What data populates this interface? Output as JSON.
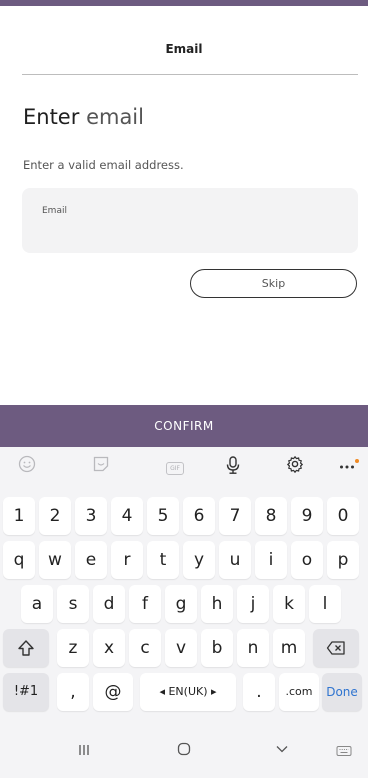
{
  "header": {
    "title": "Email"
  },
  "heading": {
    "strong": "Enter",
    "light": "email"
  },
  "hint": "Enter a valid email address.",
  "email_field": {
    "label": "Email",
    "value": "",
    "placeholder": ""
  },
  "skip_label": "Skip",
  "confirm_label": "CONFIRM",
  "keyboard": {
    "number_row": [
      "1",
      "2",
      "3",
      "4",
      "5",
      "6",
      "7",
      "8",
      "9",
      "0"
    ],
    "row1": [
      "q",
      "w",
      "e",
      "r",
      "t",
      "y",
      "u",
      "i",
      "o",
      "p"
    ],
    "row2": [
      "a",
      "s",
      "d",
      "f",
      "g",
      "h",
      "j",
      "k",
      "l"
    ],
    "row3": [
      "z",
      "x",
      "c",
      "v",
      "b",
      "n",
      "m"
    ],
    "symbols_label": "!#1",
    "comma": ",",
    "at": "@",
    "language": "◂ EN(UK) ▸",
    "period": ".",
    "dotcom": ".com",
    "done": "Done"
  },
  "icons": {
    "emoji": "emoji-icon",
    "sticker": "sticker-icon",
    "gif": "GIF",
    "mic": "microphone-icon",
    "settings": "gear-icon",
    "more": "more-icon",
    "shift": "shift-icon",
    "backspace": "backspace-icon"
  },
  "colors": {
    "brand": "#6d5b80",
    "done": "#2f74d0",
    "notification_dot": "#f08a24"
  }
}
